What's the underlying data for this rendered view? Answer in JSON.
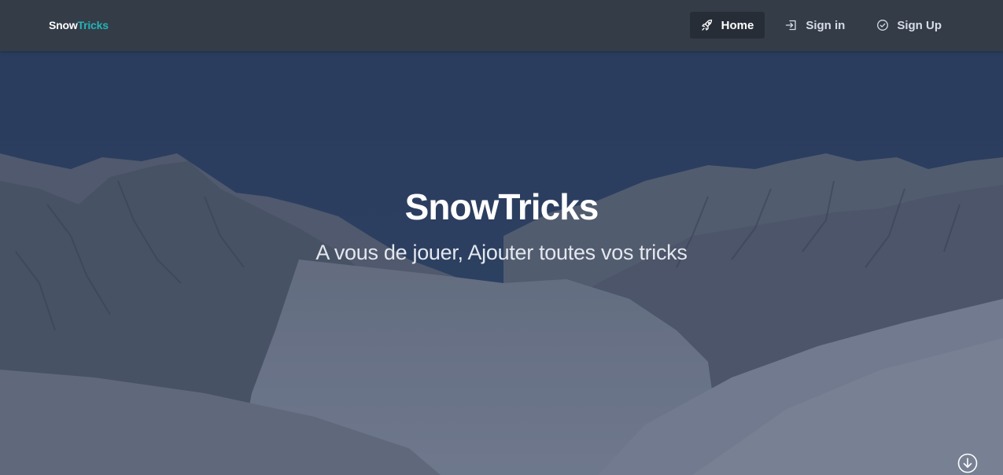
{
  "navbar": {
    "brand_part1": "Snow",
    "brand_part2": "Tricks",
    "brand_accent_color": "#26b3b6",
    "items": [
      {
        "label": "Home",
        "icon": "rocket-icon",
        "active": true
      },
      {
        "label": "Sign in",
        "icon": "sign-in-icon",
        "active": false
      },
      {
        "label": "Sign Up",
        "icon": "check-circle-icon",
        "active": false
      }
    ]
  },
  "hero": {
    "title": "SnowTricks",
    "subtitle": "A vous de jouer, Ajouter toutes vos tricks",
    "background": "snowy-mountain-landscape",
    "scroll_icon": "arrow-down-circle-icon"
  }
}
